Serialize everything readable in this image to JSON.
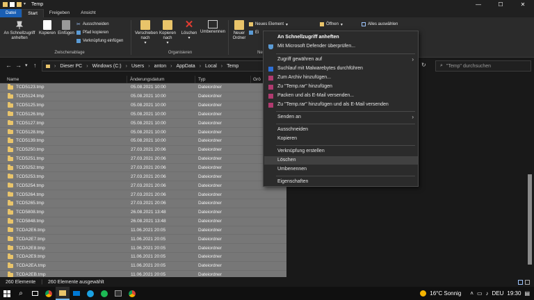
{
  "window": {
    "title": "Temp",
    "minimize": "—",
    "maximize": "☐",
    "close": "✕"
  },
  "ribbon_tabs": [
    "Datei",
    "Start",
    "Freigeben",
    "Ansicht"
  ],
  "ribbon": {
    "pin_quick_access": "An Schnellzugriff anheften",
    "copy": "Kopieren",
    "paste": "Einfügen",
    "cut": "Ausschneiden",
    "copy_path": "Pfad kopieren",
    "paste_shortcut": "Verknüpfung einfügen",
    "clipboard_group": "Zwischenablage",
    "move_to": "Verschieben nach",
    "copy_to": "Kopieren nach",
    "delete": "Löschen",
    "rename": "Umbenennen",
    "organize_group": "Organisieren",
    "new_folder": "Neuer Ordner",
    "new_item": "Neues Element",
    "easy_access": "Ei",
    "new_group": "Ne",
    "open": "Öffnen",
    "select_all": "Alles auswählen"
  },
  "address": {
    "crumbs": [
      "Dieser PC",
      "Windows (C:)",
      "Users",
      "anton",
      "AppData",
      "Local",
      "Temp"
    ],
    "search_placeholder": "\"Temp\" durchsuchen"
  },
  "columns": {
    "name": "Name",
    "date": "Änderungsdatum",
    "type": "Typ",
    "size": "Grö"
  },
  "files": [
    {
      "name": "TCD5123.tmp",
      "date": "05.08.2021 10:00",
      "type": "Dateiordner"
    },
    {
      "name": "TCD5124.tmp",
      "date": "05.08.2021 10:00",
      "type": "Dateiordner"
    },
    {
      "name": "TCD5125.tmp",
      "date": "05.08.2021 10:00",
      "type": "Dateiordner"
    },
    {
      "name": "TCD5126.tmp",
      "date": "05.08.2021 10:00",
      "type": "Dateiordner"
    },
    {
      "name": "TCD5127.tmp",
      "date": "05.08.2021 10:00",
      "type": "Dateiordner"
    },
    {
      "name": "TCD5128.tmp",
      "date": "05.08.2021 10:00",
      "type": "Dateiordner"
    },
    {
      "name": "TCD5139.tmp",
      "date": "05.08.2021 10:00",
      "type": "Dateiordner"
    },
    {
      "name": "TCD5250.tmp",
      "date": "27.03.2021 20:06",
      "type": "Dateiordner"
    },
    {
      "name": "TCD5251.tmp",
      "date": "27.03.2021 20:06",
      "type": "Dateiordner"
    },
    {
      "name": "TCD5252.tmp",
      "date": "27.03.2021 20:06",
      "type": "Dateiordner"
    },
    {
      "name": "TCD5253.tmp",
      "date": "27.03.2021 20:06",
      "type": "Dateiordner"
    },
    {
      "name": "TCD5254.tmp",
      "date": "27.03.2021 20:06",
      "type": "Dateiordner"
    },
    {
      "name": "TCD5264.tmp",
      "date": "27.03.2021 20:06",
      "type": "Dateiordner"
    },
    {
      "name": "TCD5265.tmp",
      "date": "27.03.2021 20:06",
      "type": "Dateiordner"
    },
    {
      "name": "TCD5808.tmp",
      "date": "26.08.2021 13:48",
      "type": "Dateiordner"
    },
    {
      "name": "TCD5848.tmp",
      "date": "26.08.2021 13:48",
      "type": "Dateiordner"
    },
    {
      "name": "TCDA2E6.tmp",
      "date": "11.06.2021 20:05",
      "type": "Dateiordner"
    },
    {
      "name": "TCDA2E7.tmp",
      "date": "11.06.2021 20:05",
      "type": "Dateiordner"
    },
    {
      "name": "TCDA2E8.tmp",
      "date": "11.06.2021 20:05",
      "type": "Dateiordner"
    },
    {
      "name": "TCDA2E9.tmp",
      "date": "11.06.2021 20:05",
      "type": "Dateiordner"
    },
    {
      "name": "TCDA2EA.tmp",
      "date": "11.06.2021 20:05",
      "type": "Dateiordner"
    },
    {
      "name": "TCDA2EB.tmp",
      "date": "11.06.2021 20:05",
      "type": "Dateiordner"
    }
  ],
  "status": {
    "count": "260 Elemente",
    "selected": "260 Elemente ausgewählt"
  },
  "context_menu": {
    "pin_quick_access": "An Schnellzugriff anheften",
    "defender": "Mit Microsoft Defender überprüfen...",
    "grant_access": "Zugriff gewähren auf",
    "malware_scan": "Suchlauf mit Malwarebytes durchführen",
    "add_archive": "Zum Archiv hinzufügen...",
    "add_temp_rar": "Zu \"Temp.rar\" hinzufügen",
    "pack_email": "Packen und als E-Mail versenden...",
    "temp_rar_email": "Zu \"Temp.rar\" hinzufügen und als E-Mail versenden",
    "send_to": "Senden an",
    "cut": "Ausschneiden",
    "copy": "Kopieren",
    "create_shortcut": "Verknüpfung erstellen",
    "delete": "Löschen",
    "rename": "Umbenennen",
    "properties": "Eigenschaften"
  },
  "taskbar": {
    "weather": "16°C  Sonnig",
    "lang": "DEU",
    "time": "19:30"
  },
  "colors": {
    "accent": "#1a5fb4",
    "selection": "#777777",
    "folder": "#e9c46a"
  }
}
